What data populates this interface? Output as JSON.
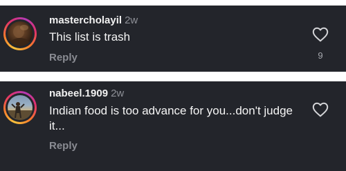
{
  "comments": [
    {
      "username": "mastercholayil",
      "time": "2w",
      "text": "This list is trash",
      "reply_label": "Reply",
      "likes": "9",
      "like_icon": "heart-outline-icon"
    },
    {
      "username": "nabeel.1909",
      "time": "2w",
      "text": "Indian food is too advance for you...don't judge it...",
      "reply_label": "Reply",
      "like_icon": "heart-outline-icon"
    }
  ],
  "colors": {
    "background": "#23252b",
    "text": "#f5f5f5",
    "muted": "#8e9097",
    "story_ring": [
      "#f9c33c",
      "#e1306c",
      "#b23ab4"
    ]
  }
}
